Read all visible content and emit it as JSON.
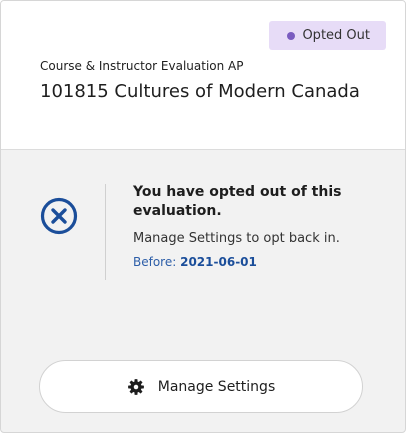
{
  "status_badge": {
    "label": "Opted Out",
    "dot_color": "#7a5cc0",
    "background": "#e7dcf7"
  },
  "course": {
    "category": "Course & Instructor Evaluation AP",
    "title": "101815 Cultures of Modern Canada"
  },
  "status_message": {
    "icon": "circle-x-icon",
    "title": "You have opted out of this evaluation.",
    "subtitle": "Manage Settings to opt back in.",
    "before_label": "Before:",
    "before_date": "2021-06-01"
  },
  "actions": {
    "manage_settings_label": "Manage Settings",
    "manage_settings_icon": "gear-icon"
  },
  "colors": {
    "accent_blue": "#1b4e9a"
  }
}
